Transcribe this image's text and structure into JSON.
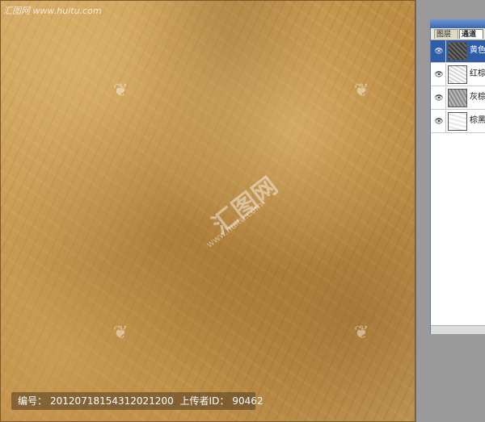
{
  "watermarks": {
    "top_left": "汇图网 www.huitu.com",
    "center": "汇图网",
    "center_sub": "www.huitu.com"
  },
  "bottom_info": {
    "id_label": "编号：",
    "id_value": "20120718154312021200",
    "uploader_label": "上传者ID：",
    "uploader_value": "90462"
  },
  "panel": {
    "tabs": [
      {
        "label": "图层"
      },
      {
        "label": "通道"
      }
    ],
    "channels": [
      {
        "label": "黄色",
        "selected": true,
        "visible_icon": "eye-icon"
      },
      {
        "label": "红棕",
        "selected": false,
        "visible_icon": "eye-icon"
      },
      {
        "label": "灰棕",
        "selected": false,
        "visible_icon": "eye-icon"
      },
      {
        "label": "棕黑",
        "selected": false,
        "visible_icon": "eye-icon"
      }
    ]
  },
  "colors": {
    "texture_base": "#c79a55",
    "panel_selected": "#2f5ea8"
  }
}
